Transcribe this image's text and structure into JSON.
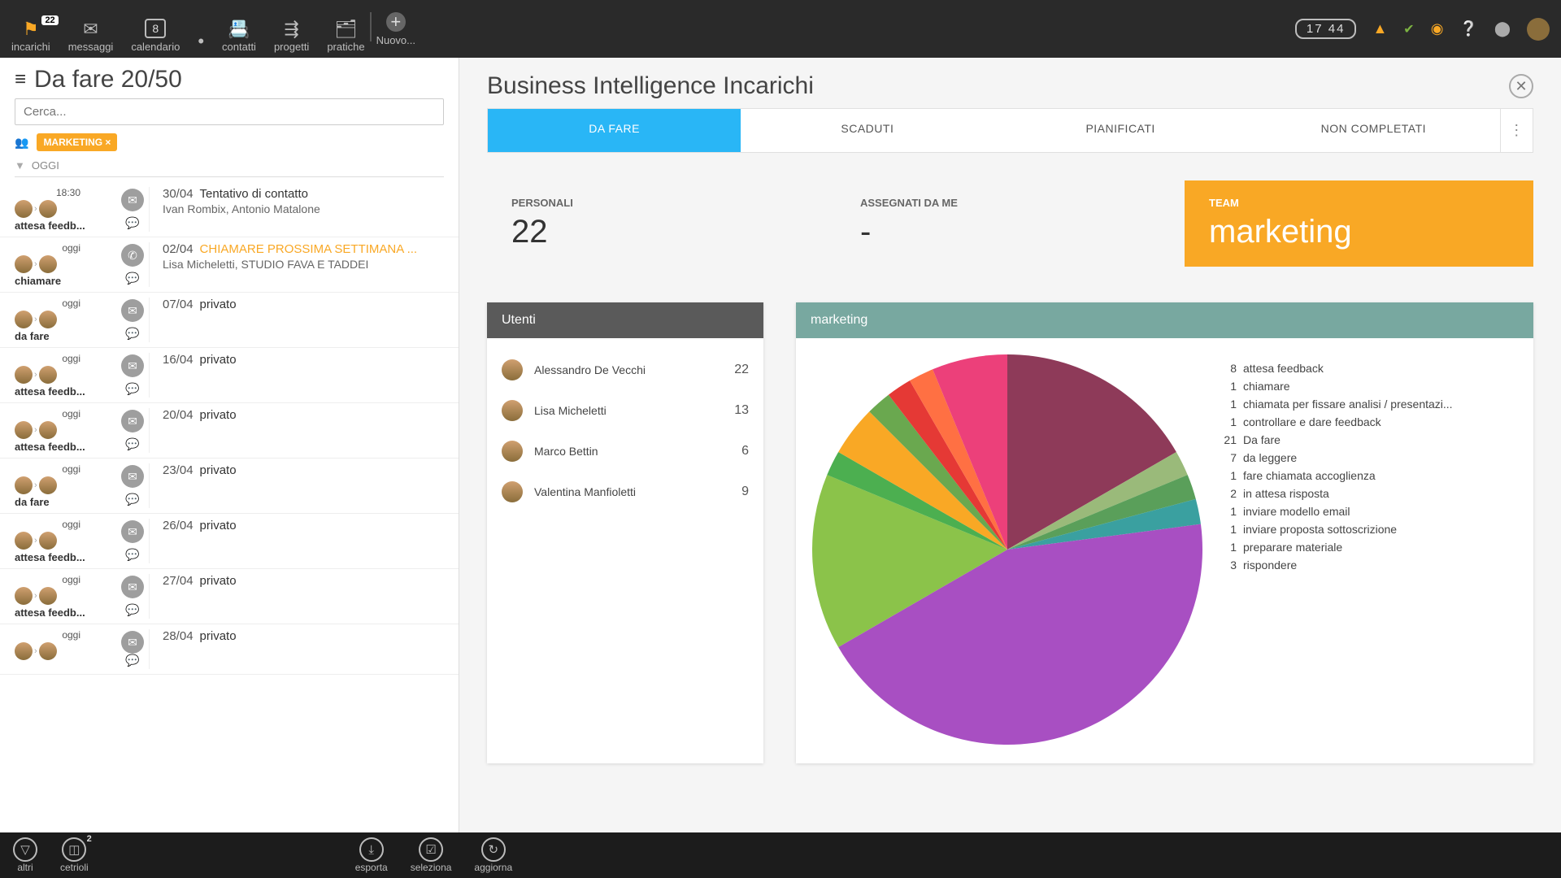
{
  "topnav": {
    "items": [
      {
        "icon": "⚑",
        "label": "incarichi",
        "badge": "22",
        "flag": true
      },
      {
        "icon": "✉",
        "label": "messaggi"
      },
      {
        "icon": "📅",
        "label": "calendario",
        "calday": "8"
      },
      {
        "icon": "•",
        "label": ""
      },
      {
        "icon": "📇",
        "label": "contatti"
      },
      {
        "icon": "⇶",
        "label": "progetti"
      },
      {
        "icon": "🗂",
        "label": "pratiche"
      }
    ],
    "nuovo": {
      "icon": "+",
      "label": "Nuovo..."
    },
    "clock": "17 44"
  },
  "left": {
    "title": "Da fare 20/50",
    "search_placeholder": "Cerca...",
    "filter_tag": "MARKETING ×",
    "date_filter": "OGGI",
    "tasks": [
      {
        "time": "18:30",
        "status": "attesa feedb...",
        "icon": "✉",
        "date": "30/04",
        "subject": "Tentativo di contatto",
        "people": "Ivan Rombix, Antonio Matalone"
      },
      {
        "time": "oggi",
        "status": "chiamare",
        "icon": "✆",
        "date": "02/04",
        "subject": "CHIAMARE PROSSIMA SETTIMANA ...",
        "people": "Lisa Micheletti, STUDIO FAVA E TADDEI",
        "highlight": true
      },
      {
        "time": "oggi",
        "status": "da fare",
        "icon": "✉",
        "date": "07/04",
        "subject": "privato",
        "people": ""
      },
      {
        "time": "oggi",
        "status": "attesa feedb...",
        "icon": "✉",
        "date": "16/04",
        "subject": "privato",
        "people": ""
      },
      {
        "time": "oggi",
        "status": "attesa feedb...",
        "icon": "✉",
        "date": "20/04",
        "subject": "privato",
        "people": ""
      },
      {
        "time": "oggi",
        "status": "da fare",
        "icon": "✉",
        "date": "23/04",
        "subject": "privato",
        "people": ""
      },
      {
        "time": "oggi",
        "status": "attesa feedb...",
        "icon": "✉",
        "date": "26/04",
        "subject": "privato",
        "people": ""
      },
      {
        "time": "oggi",
        "status": "attesa feedb...",
        "icon": "✉",
        "date": "27/04",
        "subject": "privato",
        "people": ""
      },
      {
        "time": "oggi",
        "status": "",
        "icon": "✉",
        "date": "28/04",
        "subject": "privato",
        "people": ""
      }
    ]
  },
  "bi": {
    "title": "Business Intelligence Incarichi",
    "tabs": [
      "DA FARE",
      "SCADUTI",
      "PIANIFICATI",
      "NON COMPLETATI"
    ],
    "cards": {
      "personali": {
        "label": "PERSONALI",
        "value": "22"
      },
      "assegnati": {
        "label": "ASSEGNATI DA ME",
        "value": "-"
      },
      "team": {
        "label": "TEAM",
        "value": "marketing"
      }
    },
    "users_panel": {
      "title": "Utenti",
      "rows": [
        {
          "name": "Alessandro De Vecchi",
          "count": "22"
        },
        {
          "name": "Lisa Micheletti",
          "count": "13"
        },
        {
          "name": "Marco Bettin",
          "count": "6"
        },
        {
          "name": "Valentina Manfioletti",
          "count": "9"
        }
      ]
    },
    "chart_panel": {
      "title": "marketing"
    }
  },
  "chart_data": {
    "type": "pie",
    "title": "marketing",
    "series": [
      {
        "name": "attesa feedback",
        "value": 8,
        "color": "#8e3a59"
      },
      {
        "name": "chiamare",
        "value": 1,
        "color": "#9aba7a"
      },
      {
        "name": "chiamata per fissare analisi / presentazi...",
        "value": 1,
        "color": "#5a9f5a"
      },
      {
        "name": "controllare e dare feedback",
        "value": 1,
        "color": "#3aa0a0"
      },
      {
        "name": "Da fare",
        "value": 21,
        "color": "#a84fc2"
      },
      {
        "name": "da leggere",
        "value": 7,
        "color": "#8bc34a"
      },
      {
        "name": "fare chiamata accoglienza",
        "value": 1,
        "color": "#4caf50"
      },
      {
        "name": "in attesa risposta",
        "value": 2,
        "color": "#f9a825"
      },
      {
        "name": "inviare modello email",
        "value": 1,
        "color": "#6aa84f"
      },
      {
        "name": "inviare proposta sottoscrizione",
        "value": 1,
        "color": "#e53935"
      },
      {
        "name": "preparare materiale",
        "value": 1,
        "color": "#ff7043"
      },
      {
        "name": "rispondere",
        "value": 3,
        "color": "#ec407a"
      }
    ]
  },
  "bottombar": {
    "left": [
      {
        "icon": "▽",
        "label": "altri"
      },
      {
        "icon": "◫",
        "label": "cetrioli",
        "badge": "2"
      }
    ],
    "right": [
      {
        "icon": "⤓",
        "label": "esporta"
      },
      {
        "icon": "☑",
        "label": "seleziona"
      },
      {
        "icon": "↻",
        "label": "aggiorna"
      }
    ]
  }
}
